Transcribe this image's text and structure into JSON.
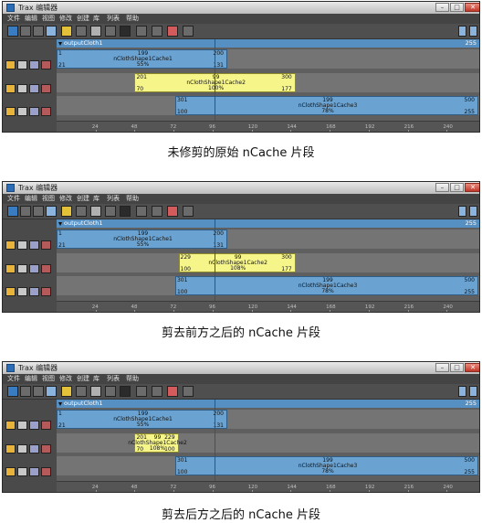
{
  "window": {
    "title": "Trax 编辑器",
    "app_icon": "trax-app-icon"
  },
  "menu": [
    "文件",
    "编辑",
    "视图",
    "修改",
    "创建",
    "库",
    "列表",
    "帮助"
  ],
  "toolbar": {
    "icons": [
      "load-clip-icon",
      "save-clip-icon",
      "graph-icon",
      "dope-sheet-icon",
      "trim-icon",
      "scale-icon",
      "curve-icon",
      "camera-icon",
      "ins-icon",
      "track-split-icon",
      "track-merge-icon",
      "loop-icon",
      "key-icon"
    ]
  },
  "ruler": {
    "ticks": [
      "24",
      "48",
      "72",
      "96",
      "120",
      "144",
      "168",
      "192",
      "216",
      "240"
    ]
  },
  "current_frame": "100",
  "panels": [
    {
      "caption": "未修剪的原始 nCache 片段",
      "header": {
        "label": "outputCloth1",
        "end": "255"
      },
      "clips": [
        {
          "color": "blue",
          "tl": "1",
          "tm": "199",
          "tr": "200",
          "name": "nClothShape1Cache1",
          "pct": "55%",
          "bl": "21",
          "br": "131"
        },
        {
          "color": "yellow",
          "tl": "201",
          "tm": "99",
          "tr": "300",
          "name": "nClothShape1Cache2",
          "pct": "100%",
          "bl": "70",
          "br": "177"
        },
        {
          "color": "blue",
          "tl": "301",
          "tm": "199",
          "tr": "500",
          "name": "nClothShape1Cache3",
          "pct": "78%",
          "bl": "100",
          "br": "255"
        }
      ]
    },
    {
      "caption": "剪去前方之后的 nCache 片段",
      "header": {
        "label": "outputCloth1",
        "end": "255"
      },
      "clips": [
        {
          "color": "blue",
          "tl": "1",
          "tm": "199",
          "tr": "200",
          "name": "nClothShape1Cache1",
          "pct": "55%",
          "bl": "21",
          "br": "131"
        },
        {
          "color": "yellow",
          "tl": "229",
          "tm": "99",
          "tr": "300",
          "name": "nClothShape1Cache2",
          "pct": "108%",
          "bl": "100",
          "br": "177"
        },
        {
          "color": "blue",
          "tl": "301",
          "tm": "199",
          "tr": "500",
          "name": "nClothShape1Cache3",
          "pct": "78%",
          "bl": "100",
          "br": "255"
        }
      ]
    },
    {
      "caption": "剪去后方之后的 nCache 片段",
      "header": {
        "label": "outputCloth1",
        "end": "255"
      },
      "clips": [
        {
          "color": "blue",
          "tl": "1",
          "tm": "199",
          "tr": "200",
          "name": "nClothShape1Cache1",
          "pct": "55%",
          "bl": "21",
          "br": "131"
        },
        {
          "color": "yellow",
          "tl": "201",
          "tm": "99",
          "tr": "229",
          "name": "nClothShape1Cache2",
          "pct": "108%",
          "bl": "70",
          "br": "100"
        },
        {
          "color": "blue",
          "tl": "301",
          "tm": "199",
          "tr": "500",
          "name": "nClothShape1Cache3",
          "pct": "78%",
          "bl": "100",
          "br": "255"
        }
      ]
    }
  ]
}
